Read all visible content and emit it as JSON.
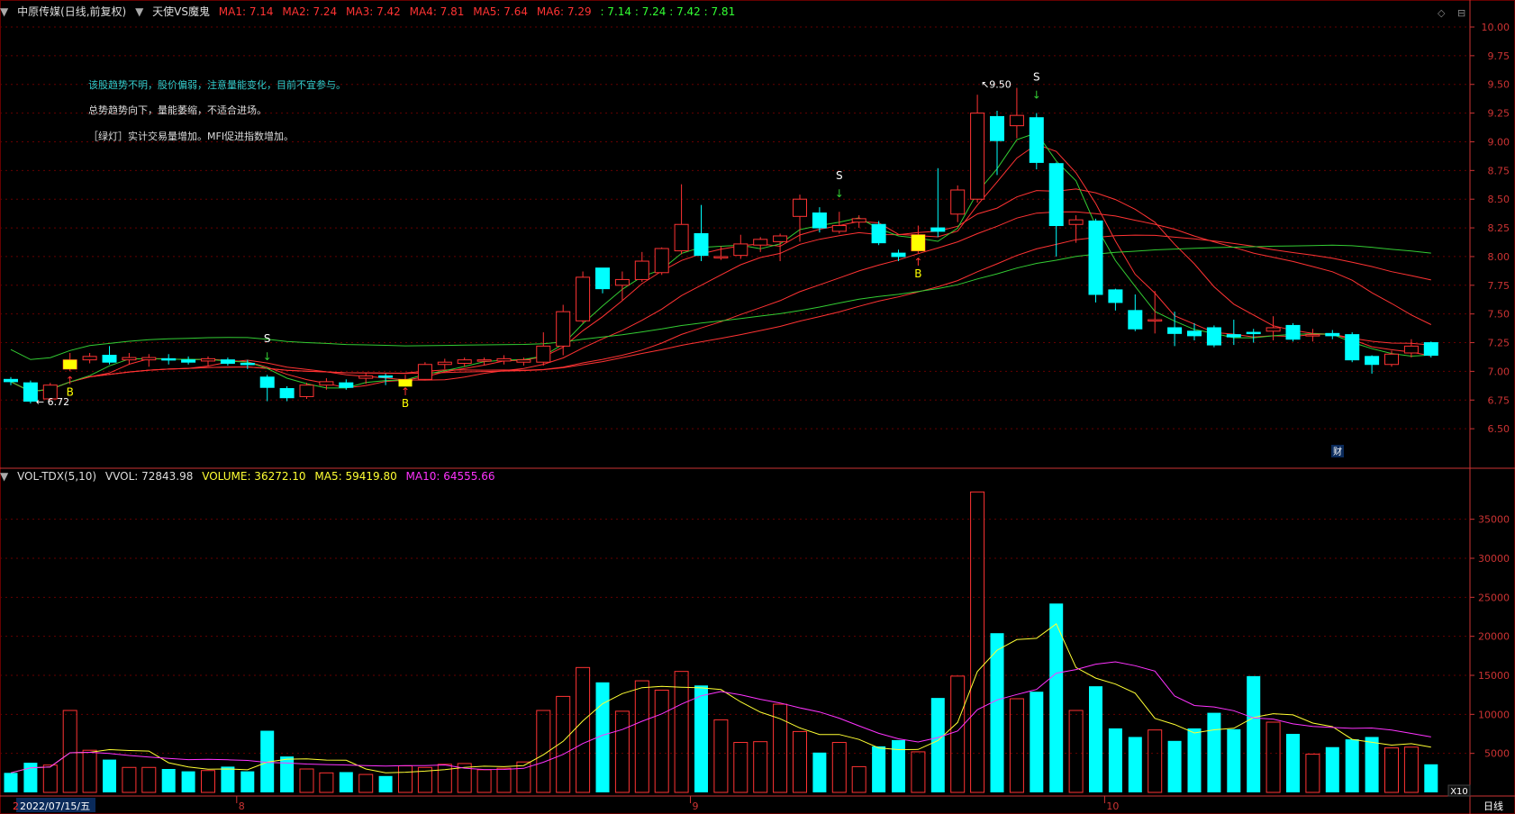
{
  "header": {
    "stock_name": "中原传媒(日线,前复权)",
    "indicator_name": "天使VS魔鬼",
    "ma_values": [
      {
        "label": "MA1: 7.14",
        "color": "#ff3333"
      },
      {
        "label": "MA2: 7.24",
        "color": "#ff3333"
      },
      {
        "label": "MA3: 7.42",
        "color": "#ff3333"
      },
      {
        "label": "MA4: 7.81",
        "color": "#ff3333"
      },
      {
        "label": "MA5: 7.64",
        "color": "#ff3333"
      },
      {
        "label": "MA6: 7.29",
        "color": "#ff3333"
      }
    ],
    "extra_values": ": 7.14 : 7.24 : 7.42 : 7.81",
    "extra_color": "#33ff33"
  },
  "notes": [
    {
      "text": "该股趋势不明，股价偏弱，注意量能变化，目前不宜参与。",
      "color": "#33cccc"
    },
    {
      "text": "总势趋势向下，量能萎缩，不适合进场。",
      "color": "#dddddd"
    },
    {
      "text": "［绿灯］实计交易量增加。MFI促进指数增加。",
      "color": "#dddddd"
    }
  ],
  "volume_header": {
    "name": "VOL-TDX(5,10)",
    "vvol": "VVOL: 72843.98",
    "volume": "VOLUME: 36272.10",
    "ma5": "MA5: 59419.80",
    "ma10": "MA10: 64555.66"
  },
  "colors": {
    "up": "#ff3333",
    "down": "#00ffff",
    "grid": "#660000",
    "axis": "#cc3333",
    "ma_short": "#ffffff",
    "ma_green": "#33cc33",
    "vol_ma5": "#ffff33",
    "vol_ma10": "#ff33ff",
    "signal_yellow": "#ffff00"
  },
  "bottom_labels": {
    "date": "2022/07/15/五",
    "m8": "8",
    "m9": "9",
    "m10": "10",
    "period": "日线",
    "scale": "X10",
    "cai": "财",
    "left_mark": "2"
  },
  "annotations": {
    "high": "9.50",
    "low": "6.72",
    "s": "S",
    "b": "B"
  },
  "chart_data": {
    "type": "candlestick",
    "title": "中原传媒(日线,前复权)",
    "price_axis": {
      "ylim": [
        6.25,
        10.0
      ],
      "ticks": [
        "10.00",
        "9.75",
        "9.50",
        "9.25",
        "9.00",
        "8.75",
        "8.50",
        "8.25",
        "8.00",
        "7.75",
        "7.50",
        "7.25",
        "7.00",
        "6.75",
        "6.50"
      ]
    },
    "volume_axis": {
      "ylim": [
        0,
        39000
      ],
      "ticks": [
        "35000",
        "30000",
        "25000",
        "20000",
        "15000",
        "10000",
        "5000"
      ]
    },
    "months": [
      {
        "label": "8",
        "index": 12
      },
      {
        "label": "9",
        "index": 35
      },
      {
        "label": "10",
        "index": 56
      }
    ],
    "high_mark": {
      "index": 49,
      "value": 9.5
    },
    "low_mark": {
      "index": 1,
      "value": 6.72
    },
    "candles": [
      {
        "o": 6.93,
        "c": 6.91,
        "h": 6.95,
        "l": 6.88,
        "v": 2500
      },
      {
        "o": 6.9,
        "c": 6.74,
        "h": 6.92,
        "l": 6.72,
        "v": 3800
      },
      {
        "o": 6.76,
        "c": 6.88,
        "h": 6.9,
        "l": 6.74,
        "v": 3500
      },
      {
        "o": 7.02,
        "c": 7.1,
        "h": 7.16,
        "l": 7.0,
        "v": 10500
      },
      {
        "o": 7.1,
        "c": 7.13,
        "h": 7.16,
        "l": 7.07,
        "v": 5400
      },
      {
        "o": 7.14,
        "c": 7.08,
        "h": 7.22,
        "l": 7.06,
        "v": 4200
      },
      {
        "o": 7.1,
        "c": 7.12,
        "h": 7.16,
        "l": 7.06,
        "v": 3200
      },
      {
        "o": 7.1,
        "c": 7.12,
        "h": 7.15,
        "l": 7.04,
        "v": 3200
      },
      {
        "o": 7.11,
        "c": 7.1,
        "h": 7.15,
        "l": 7.06,
        "v": 3000
      },
      {
        "o": 7.1,
        "c": 7.08,
        "h": 7.13,
        "l": 7.06,
        "v": 2700
      },
      {
        "o": 7.09,
        "c": 7.11,
        "h": 7.13,
        "l": 7.05,
        "v": 2800
      },
      {
        "o": 7.1,
        "c": 7.07,
        "h": 7.12,
        "l": 7.05,
        "v": 3300
      },
      {
        "o": 7.07,
        "c": 7.06,
        "h": 7.1,
        "l": 7.02,
        "v": 2700
      },
      {
        "o": 6.95,
        "c": 6.86,
        "h": 6.97,
        "l": 6.74,
        "v": 7900
      },
      {
        "o": 6.85,
        "c": 6.77,
        "h": 6.87,
        "l": 6.74,
        "v": 4600
      },
      {
        "o": 6.78,
        "c": 6.88,
        "h": 6.9,
        "l": 6.76,
        "v": 3000
      },
      {
        "o": 6.88,
        "c": 6.91,
        "h": 6.94,
        "l": 6.84,
        "v": 2500
      },
      {
        "o": 6.9,
        "c": 6.86,
        "h": 6.93,
        "l": 6.84,
        "v": 2600
      },
      {
        "o": 6.94,
        "c": 6.96,
        "h": 6.99,
        "l": 6.89,
        "v": 2300
      },
      {
        "o": 6.96,
        "c": 6.95,
        "h": 6.98,
        "l": 6.88,
        "v": 2100
      },
      {
        "o": 6.93,
        "c": 6.93,
        "h": 6.97,
        "l": 6.9,
        "v": 3400
      },
      {
        "o": 6.93,
        "c": 7.06,
        "h": 7.08,
        "l": 6.92,
        "v": 3200
      },
      {
        "o": 7.06,
        "c": 7.08,
        "h": 7.11,
        "l": 7.02,
        "v": 3600
      },
      {
        "o": 7.07,
        "c": 7.1,
        "h": 7.12,
        "l": 7.04,
        "v": 3700
      },
      {
        "o": 7.09,
        "c": 7.1,
        "h": 7.12,
        "l": 7.05,
        "v": 2900
      },
      {
        "o": 7.09,
        "c": 7.11,
        "h": 7.14,
        "l": 7.06,
        "v": 3100
      },
      {
        "o": 7.08,
        "c": 7.1,
        "h": 7.12,
        "l": 7.05,
        "v": 3900
      },
      {
        "o": 7.08,
        "c": 7.22,
        "h": 7.34,
        "l": 7.05,
        "v": 10500
      },
      {
        "o": 7.22,
        "c": 7.52,
        "h": 7.58,
        "l": 7.14,
        "v": 12300
      },
      {
        "o": 7.44,
        "c": 7.82,
        "h": 7.87,
        "l": 7.42,
        "v": 16000
      },
      {
        "o": 7.9,
        "c": 7.72,
        "h": 7.9,
        "l": 7.68,
        "v": 14100
      },
      {
        "o": 7.75,
        "c": 7.8,
        "h": 7.87,
        "l": 7.62,
        "v": 10400
      },
      {
        "o": 7.8,
        "c": 7.96,
        "h": 8.04,
        "l": 7.78,
        "v": 14300
      },
      {
        "o": 7.86,
        "c": 8.07,
        "h": 8.08,
        "l": 7.84,
        "v": 13100
      },
      {
        "o": 8.05,
        "c": 8.28,
        "h": 8.63,
        "l": 8.02,
        "v": 15500
      },
      {
        "o": 8.2,
        "c": 8.01,
        "h": 8.45,
        "l": 7.96,
        "v": 13700
      },
      {
        "o": 8.0,
        "c": 8.0,
        "h": 8.09,
        "l": 7.97,
        "v": 9300
      },
      {
        "o": 8.01,
        "c": 8.11,
        "h": 8.19,
        "l": 7.98,
        "v": 6400
      },
      {
        "o": 8.1,
        "c": 8.15,
        "h": 8.17,
        "l": 8.04,
        "v": 6500
      },
      {
        "o": 8.13,
        "c": 8.18,
        "h": 8.2,
        "l": 7.96,
        "v": 11300
      },
      {
        "o": 8.35,
        "c": 8.5,
        "h": 8.54,
        "l": 8.13,
        "v": 7800
      },
      {
        "o": 8.38,
        "c": 8.25,
        "h": 8.43,
        "l": 8.21,
        "v": 5100
      },
      {
        "o": 8.22,
        "c": 8.27,
        "h": 8.39,
        "l": 8.2,
        "v": 6400
      },
      {
        "o": 8.3,
        "c": 8.33,
        "h": 8.36,
        "l": 8.25,
        "v": 3300
      },
      {
        "o": 8.28,
        "c": 8.12,
        "h": 8.31,
        "l": 8.1,
        "v": 5900
      },
      {
        "o": 8.03,
        "c": 8.0,
        "h": 8.06,
        "l": 7.96,
        "v": 6700
      },
      {
        "o": 8.05,
        "c": 8.19,
        "h": 8.27,
        "l": 8.03,
        "v": 5200
      },
      {
        "o": 8.25,
        "c": 8.22,
        "h": 8.77,
        "l": 8.17,
        "v": 12100
      },
      {
        "o": 8.37,
        "c": 8.58,
        "h": 8.62,
        "l": 8.3,
        "v": 14900
      },
      {
        "o": 8.5,
        "c": 9.25,
        "h": 9.41,
        "l": 8.47,
        "v": 38500
      },
      {
        "o": 9.22,
        "c": 9.01,
        "h": 9.27,
        "l": 8.71,
        "v": 20400
      },
      {
        "o": 9.14,
        "c": 9.23,
        "h": 9.47,
        "l": 9.03,
        "v": 12000
      },
      {
        "o": 9.21,
        "c": 8.82,
        "h": 9.25,
        "l": 8.76,
        "v": 12900
      },
      {
        "o": 8.81,
        "c": 8.27,
        "h": 8.82,
        "l": 8.0,
        "v": 24200
      },
      {
        "o": 8.28,
        "c": 8.32,
        "h": 8.36,
        "l": 8.12,
        "v": 10500
      },
      {
        "o": 8.31,
        "c": 7.67,
        "h": 8.33,
        "l": 7.6,
        "v": 13600
      },
      {
        "o": 7.71,
        "c": 7.6,
        "h": 7.72,
        "l": 7.53,
        "v": 8200
      },
      {
        "o": 7.53,
        "c": 7.37,
        "h": 7.67,
        "l": 7.35,
        "v": 7100
      },
      {
        "o": 7.45,
        "c": 7.45,
        "h": 7.7,
        "l": 7.33,
        "v": 8000
      },
      {
        "o": 7.38,
        "c": 7.33,
        "h": 7.52,
        "l": 7.22,
        "v": 6600
      },
      {
        "o": 7.35,
        "c": 7.31,
        "h": 7.42,
        "l": 7.27,
        "v": 8200
      },
      {
        "o": 7.38,
        "c": 7.23,
        "h": 7.4,
        "l": 7.21,
        "v": 10200
      },
      {
        "o": 7.32,
        "c": 7.3,
        "h": 7.45,
        "l": 7.23,
        "v": 8100
      },
      {
        "o": 7.34,
        "c": 7.33,
        "h": 7.37,
        "l": 7.25,
        "v": 14900
      },
      {
        "o": 7.35,
        "c": 7.38,
        "h": 7.48,
        "l": 7.27,
        "v": 9000
      },
      {
        "o": 7.4,
        "c": 7.28,
        "h": 7.42,
        "l": 7.26,
        "v": 7500
      },
      {
        "o": 7.31,
        "c": 7.32,
        "h": 7.37,
        "l": 7.26,
        "v": 4900
      },
      {
        "o": 7.33,
        "c": 7.31,
        "h": 7.36,
        "l": 7.28,
        "v": 5800
      },
      {
        "o": 7.32,
        "c": 7.1,
        "h": 7.34,
        "l": 7.08,
        "v": 6800
      },
      {
        "o": 7.13,
        "c": 7.06,
        "h": 7.14,
        "l": 6.98,
        "v": 7100
      },
      {
        "o": 7.06,
        "c": 7.15,
        "h": 7.18,
        "l": 7.04,
        "v": 5700
      },
      {
        "o": 7.16,
        "c": 7.22,
        "h": 7.28,
        "l": 7.12,
        "v": 5800
      },
      {
        "o": 7.25,
        "c": 7.14,
        "h": 7.26,
        "l": 7.12,
        "v": 3600
      }
    ],
    "signals": [
      {
        "type": "B",
        "index": 3
      },
      {
        "type": "S",
        "index": 13
      },
      {
        "type": "B",
        "index": 20
      },
      {
        "type": "S",
        "index": 42
      },
      {
        "type": "B",
        "index": 46
      },
      {
        "type": "S",
        "index": 52
      }
    ]
  }
}
